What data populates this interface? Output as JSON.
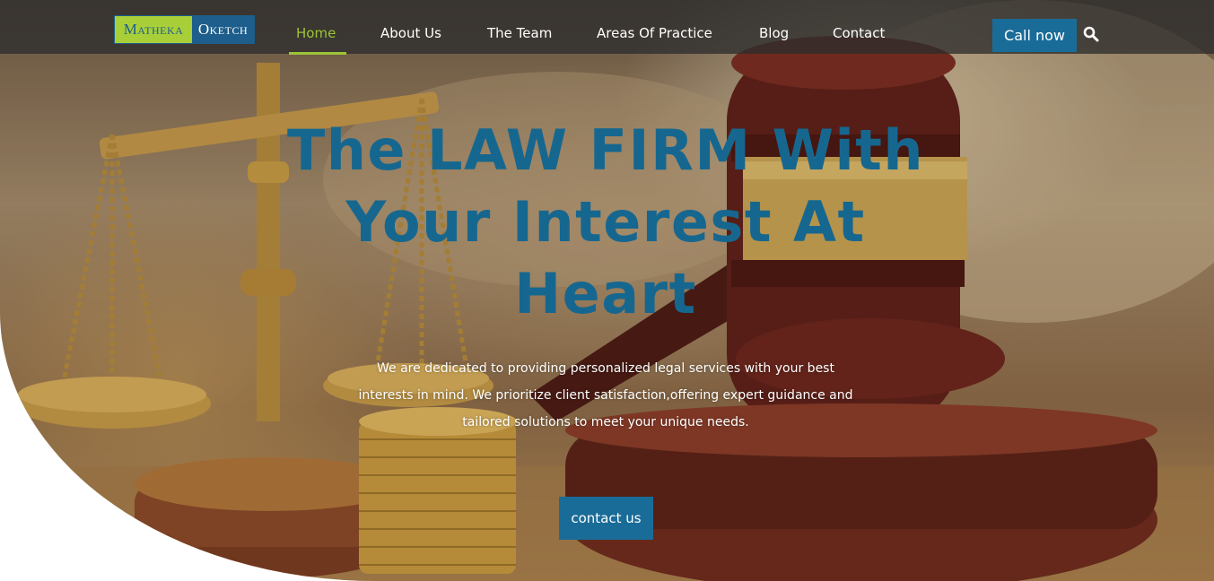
{
  "logo": {
    "left_text": "Matheka",
    "right_text": "Oketch"
  },
  "nav": {
    "items": [
      {
        "label": "Home",
        "active": true
      },
      {
        "label": "About Us",
        "active": false
      },
      {
        "label": "The Team",
        "active": false
      },
      {
        "label": "Areas Of Practice",
        "active": false
      },
      {
        "label": "Blog",
        "active": false
      },
      {
        "label": "Contact",
        "active": false
      }
    ],
    "call_label": "Call now",
    "search_icon": "search-icon"
  },
  "hero": {
    "title": "The LAW FIRM With Your Interest At Heart",
    "description": "We are dedicated to providing personalized legal services with your best interests in mind. We prioritize client satisfaction,offering expert guidance and tailored solutions to meet your unique needs.",
    "button_label": "contact us",
    "background_icon": "gavel-and-scales-photo"
  },
  "colors": {
    "brand_blue": "#1a6c98",
    "accent_green": "#9cc438",
    "logo_green": "#a9cf38",
    "title_blue": "#16678f"
  }
}
